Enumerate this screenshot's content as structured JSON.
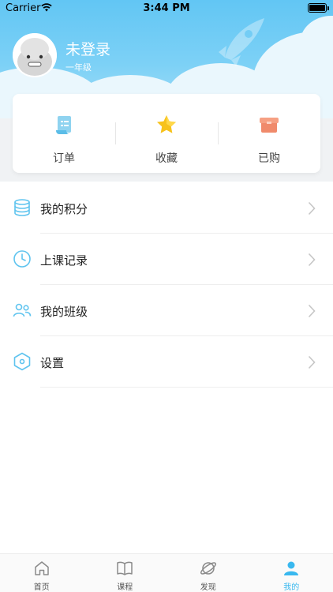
{
  "status_bar": {
    "carrier": "Carrier",
    "time": "3:44 PM"
  },
  "profile": {
    "name": "未登录",
    "grade": "一年级"
  },
  "quick_actions": [
    {
      "label": "订单",
      "icon": "order-icon"
    },
    {
      "label": "收藏",
      "icon": "star-icon"
    },
    {
      "label": "已购",
      "icon": "purchased-box-icon"
    }
  ],
  "menu": [
    {
      "label": "我的积分",
      "icon": "points-stack-icon"
    },
    {
      "label": "上课记录",
      "icon": "clock-icon"
    },
    {
      "label": "我的班级",
      "icon": "users-icon"
    },
    {
      "label": "设置",
      "icon": "settings-hexagon-icon"
    }
  ],
  "tab_bar": {
    "tabs": [
      {
        "label": "首页",
        "icon": "home-icon"
      },
      {
        "label": "课程",
        "icon": "book-icon"
      },
      {
        "label": "发现",
        "icon": "planet-icon"
      },
      {
        "label": "我的",
        "icon": "person-icon"
      }
    ],
    "active_index": 3
  },
  "colors": {
    "header": "#62c6f4",
    "accent": "#39b8ef",
    "card_bg": "#ffffff",
    "page_gray": "#f0f2f4"
  }
}
